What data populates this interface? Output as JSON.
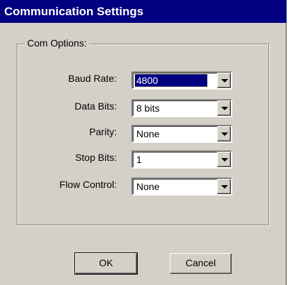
{
  "window": {
    "title": "Communication Settings"
  },
  "group": {
    "label": "Com Options:"
  },
  "fields": [
    {
      "label": "Baud Rate:",
      "value": "4800"
    },
    {
      "label": "Data Bits:",
      "value": "8 bits"
    },
    {
      "label": "Parity:",
      "value": "None"
    },
    {
      "label": "Stop Bits:",
      "value": "1"
    },
    {
      "label": "Flow Control:",
      "value": "None"
    }
  ],
  "buttons": {
    "ok": "OK",
    "cancel": "Cancel"
  },
  "icons": {
    "dropdown": "chevron-down-icon"
  },
  "colors": {
    "titlebar": "#000080",
    "face": "#d4d0c8",
    "selection": "#000080"
  }
}
